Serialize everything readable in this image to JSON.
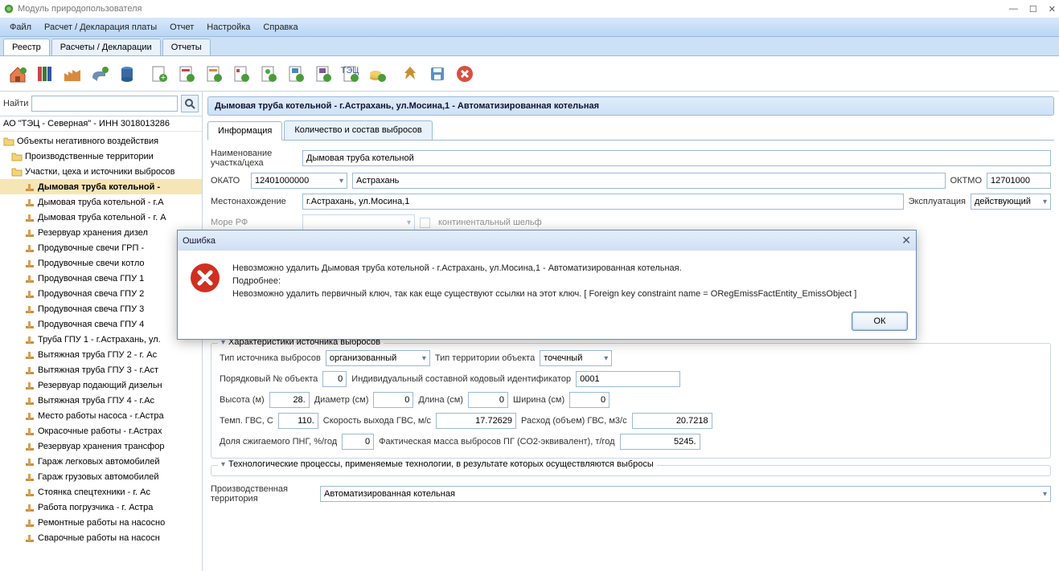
{
  "title": "Модуль природопользователя",
  "menu": [
    "Файл",
    "Расчет / Декларация платы",
    "Отчет",
    "Настройка",
    "Справка"
  ],
  "app_tabs": [
    "Реестр",
    "Расчеты / Декларации",
    "Отчеты"
  ],
  "find_label": "Найти",
  "company": "АО \"ТЭЦ - Северная\" - ИНН 3018013286",
  "tree_root": "Объекты негативного воздействия",
  "tree_l1a": "Производственные территории",
  "tree_l1b": "Участки, цеха и источники выбросов",
  "tree_items": [
    "Дымовая труба котельной  -",
    "Дымовая труба котельной - г.А",
    "Дымовая труба котельной - г. А",
    "Резервуар хранения дизел",
    "Продувочные свечи ГРП -",
    "Продувочные свечи котло",
    "Продувочная свеча ГПУ 1",
    "Продувочная свеча ГПУ  2",
    "Продувочная свеча ГПУ 3",
    "Продувочная свеча ГПУ 4",
    "Труба ГПУ 1 - г.Астрахань, ул.",
    "Вытяжная труба ГПУ 2 - г. Ас",
    "Вытяжная труба ГПУ 3 - г.Аст",
    "Резервуар подающий дизельн",
    "Вытяжная труба ГПУ 4 - г.Ас",
    "Место работы насоса - г.Астра",
    "Окрасочные работы - г.Астрах",
    "Резервуар хранения трансфор",
    "Гараж легковых автомобилей",
    "Гараж грузовых автомобилей",
    "Стоянка спецтехники - г. Ас",
    "Работа погрузчика - г. Астра",
    "Ремонтные работы на насосно",
    "Сварочные работы на насосн"
  ],
  "header": "Дымовая труба котельной  - г.Астрахань, ул.Мосина,1 - Автоматизированная котельная",
  "inner_tabs": [
    "Информация",
    "Количество и состав выбросов"
  ],
  "form": {
    "name_lbl1": "Наименование",
    "name_lbl2": "участка/цеха",
    "name_val": "Дымовая труба котельной",
    "okato_lbl": "ОКАТО",
    "okato_val": "12401000000",
    "okato_city": "Астрахань",
    "oktmo_lbl": "ОКТМО",
    "oktmo_val": "12701000",
    "loc_lbl": "Местонахождение",
    "loc_val": "г.Астрахань, ул.Мосина,1",
    "expl_lbl": "Эксплуатация",
    "expl_val": "действующий",
    "sea_lbl": "Море РФ",
    "sea_chk": "континентальный шельф",
    "fs_title": "Характеристики источника выбросов",
    "type_src_lbl": "Тип источника выбросов",
    "type_src_val": "организованный",
    "type_terr_lbl": "Тип территории объекта",
    "type_terr_val": "точечный",
    "ord_lbl": "Порядковый № объекта",
    "ord_val": "0",
    "ind_lbl": "Индивидуальный составной кодовый идентификатор",
    "ind_val": "0001",
    "h_lbl": "Высота (м)",
    "h_val": "28.",
    "d_lbl": "Диаметр (см)",
    "d_val": "0",
    "l_lbl": "Длина (см)",
    "l_val": "0",
    "w_lbl": "Ширина (см)",
    "w_val": "0",
    "t_lbl": "Темп. ГВС, С",
    "t_val": "110.",
    "v_lbl": "Скорость выхода ГВС, м/с",
    "v_val": "17.72629",
    "q_lbl": "Расход (объем) ГВС, м3/с",
    "q_val": "20.7218",
    "png_lbl": "Доля сжигаемого ПНГ, %/год",
    "png_val": "0",
    "mass_lbl": "Фактическая масса выбросов ПГ (СО2-эквивалент), т/год",
    "mass_val": "5245.",
    "tech_title": "Технологические процессы, применяемые технологии, в результате которых осуществляются выбросы",
    "prod_lbl1": "Производственная",
    "prod_lbl2": "территория",
    "prod_val": "Автоматизированная котельная"
  },
  "dialog": {
    "title": "Ошибка",
    "line1": "Невозможно удалить Дымовая труба котельной  - г.Астрахань, ул.Мосина,1 - Автоматизированная котельная.",
    "line2": "Подробнее:",
    "line3": "Невозможно удалить первичный ключ, так как еще существуют ссылки на этот ключ. [ Foreign key constraint name = ORegEmissFactEntity_EmissObject ]",
    "ok": "ОК"
  }
}
